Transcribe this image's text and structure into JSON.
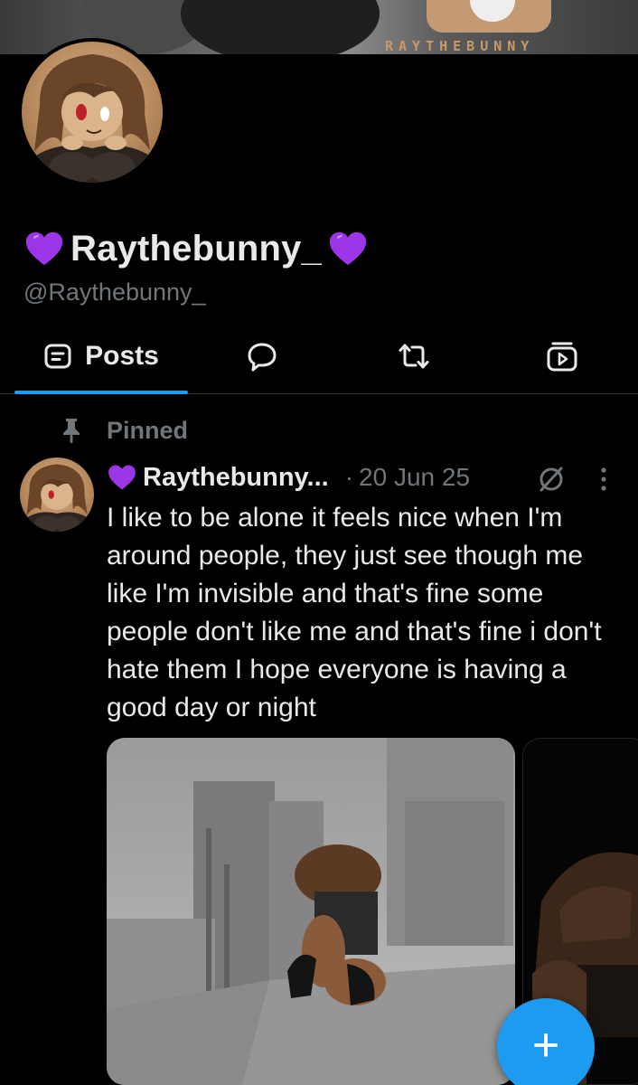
{
  "banner": {
    "logo_text": "RAYTHEBUNNY"
  },
  "profile": {
    "display_name": "Raythebunny_",
    "handle": "@Raythebunny_",
    "name_emoji": "purple-heart-icon"
  },
  "tabs": [
    {
      "label": "Posts",
      "icon": "posts-icon",
      "selected": true
    },
    {
      "label": "",
      "icon": "replies-icon",
      "selected": false
    },
    {
      "label": "",
      "icon": "reposts-icon",
      "selected": false
    },
    {
      "label": "",
      "icon": "media-icon",
      "selected": false
    }
  ],
  "pinned": {
    "label": "Pinned"
  },
  "post": {
    "author": "Raythebunny...",
    "separator": "·",
    "date": "20 Jun 25",
    "text": "I like to be alone it feels nice when I'm around people, they just see though me like I'm invisible and that's fine some people don't like me and that's fine i don't hate them I hope everyone is having a good day or night",
    "media_count": 2
  },
  "fab": {
    "label": "+"
  },
  "colors": {
    "background": "#000000",
    "accent": "#1d9bf0",
    "text_primary": "#e7e9ea",
    "text_secondary": "#71767b",
    "heart": "#9b35e6"
  }
}
